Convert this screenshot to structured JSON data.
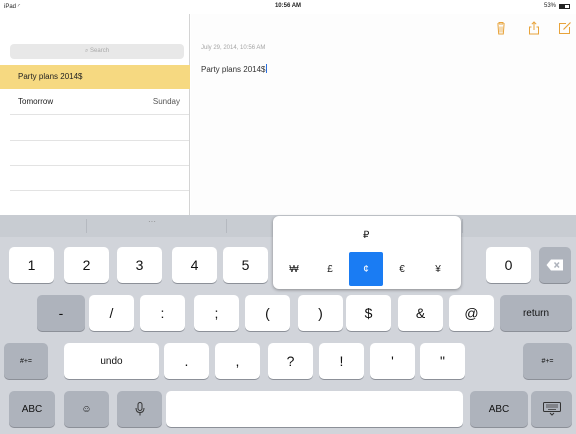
{
  "status_bar": {
    "device": "iPad",
    "wifi": "◜",
    "time": "10:56 AM",
    "battery_text": "53%"
  },
  "sidebar": {
    "search_placeholder": "Search",
    "notes": [
      {
        "title": "Party plans 2014$",
        "date": "",
        "selected": true
      },
      {
        "title": "Tomorrow",
        "date": "Sunday",
        "selected": false
      }
    ]
  },
  "note": {
    "date": "July 29, 2014, 10:56 AM",
    "body": "Party plans 2014$"
  },
  "toolbar": {
    "icons": [
      "trash-icon",
      "share-icon",
      "compose-icon"
    ],
    "accent_color": "#e8a33a"
  },
  "keyboard": {
    "predict_dots": "···",
    "row1": [
      "1",
      "2",
      "3",
      "4",
      "5",
      "0"
    ],
    "row2": [
      "-",
      "/",
      ":",
      ";",
      "(",
      ")",
      "$",
      "&",
      "@"
    ],
    "row3": [
      "#+=",
      "undo",
      ".",
      ",",
      "?",
      "!",
      "'",
      "\"",
      "#+="
    ],
    "row4": {
      "abc_left": "ABC",
      "emoji": "☺",
      "mic": "🎙",
      "abc_right": "ABC"
    },
    "return_label": "return",
    "delete_icon": "delete-icon",
    "hide_icon": "hide-keyboard-icon"
  },
  "currency_popup": {
    "top": "₽",
    "symbols": [
      "₩",
      "£",
      "¢",
      "€",
      "¥"
    ],
    "active_index": 2,
    "active_color": "#1a7cf3"
  }
}
